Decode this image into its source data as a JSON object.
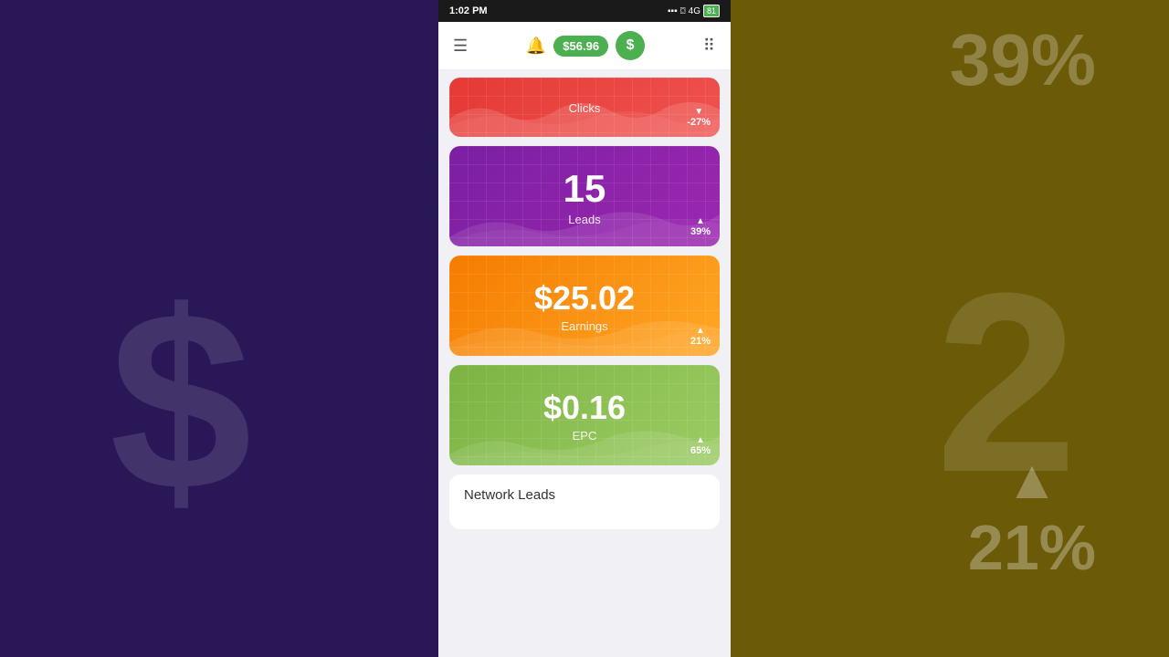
{
  "background": {
    "dollar_sign": "$",
    "two": "2",
    "percent_top": "39%",
    "percent_bottom": "21%"
  },
  "status_bar": {
    "time": "1:02 PM",
    "battery": "81"
  },
  "header": {
    "balance": "$56.96",
    "dollar_symbol": "$"
  },
  "cards": {
    "clicks": {
      "label": "Clicks",
      "change": "-27%",
      "direction": "down"
    },
    "leads": {
      "value": "15",
      "label": "Leads",
      "change": "39%",
      "direction": "up"
    },
    "earnings": {
      "value": "$25.02",
      "label": "Earnings",
      "change": "21%",
      "direction": "up"
    },
    "epc": {
      "value": "$0.16",
      "label": "EPC",
      "change": "65%",
      "direction": "up"
    }
  },
  "network_leads": {
    "title": "Network Leads"
  }
}
